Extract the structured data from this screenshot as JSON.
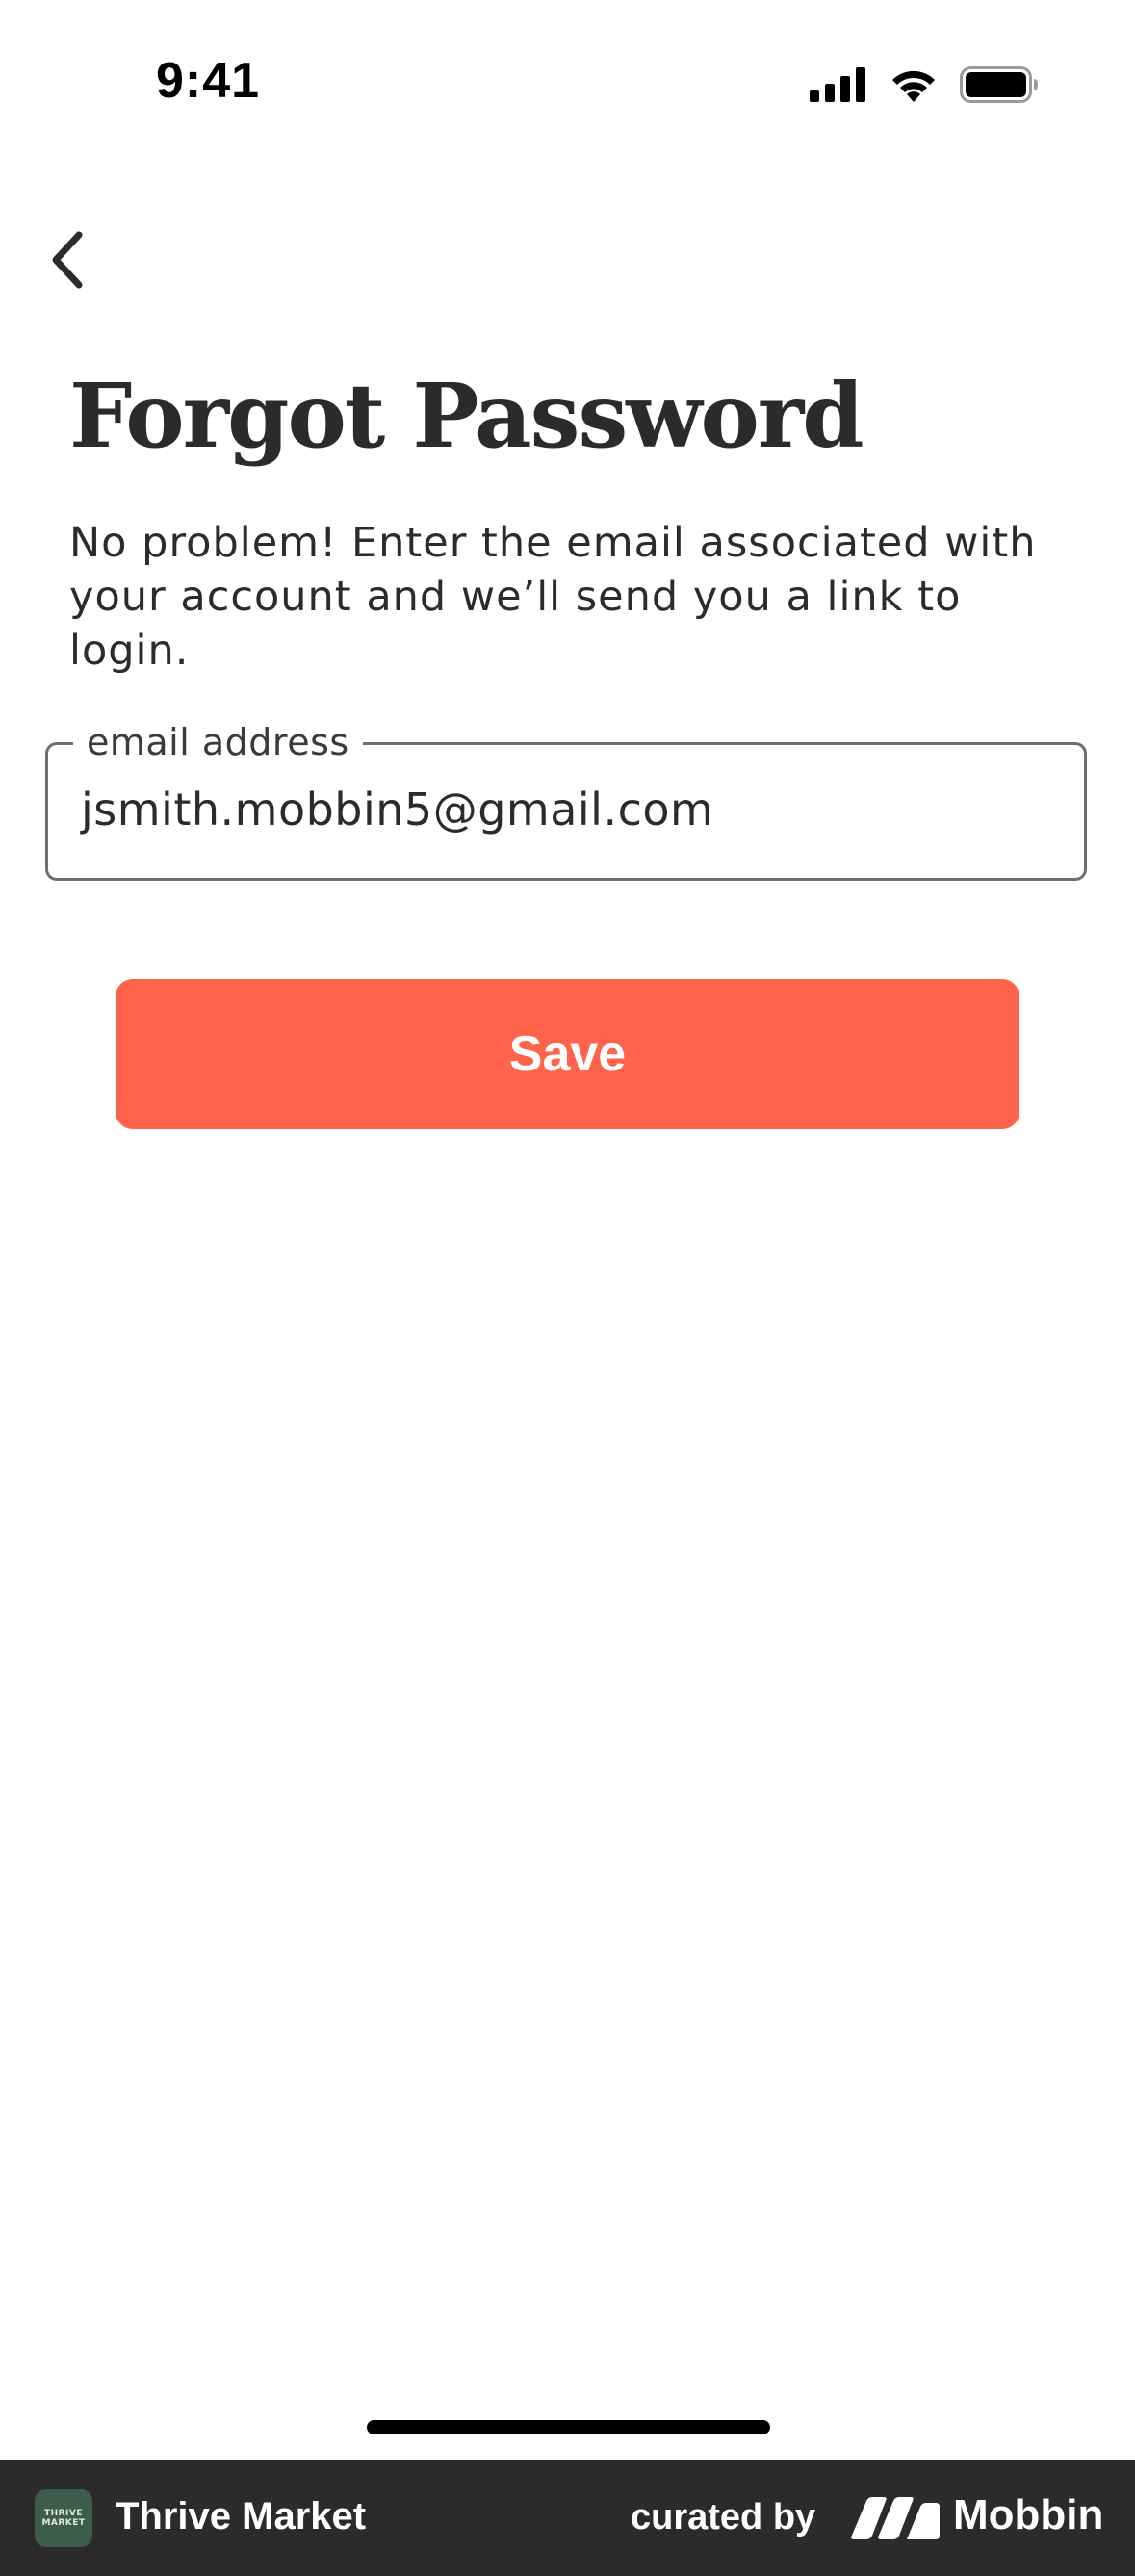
{
  "status_bar": {
    "time": "9:41",
    "icons": [
      "cellular-signal-icon",
      "wifi-icon",
      "battery-icon"
    ]
  },
  "nav": {
    "back_icon": "chevron-left-icon"
  },
  "page": {
    "title": "Forgot Password",
    "description": "No problem! Enter the email associated with your account and we’ll send you a link to login."
  },
  "form": {
    "email_label": "email address",
    "email_value": "jsmith.mobbin5@gmail.com",
    "save_label": "Save"
  },
  "footer": {
    "app_name": "Thrive Market",
    "app_logo_text": "THRIVE MARKET",
    "curated_by": "curated by",
    "brand": "Mobbin"
  },
  "colors": {
    "accent": "#fe634c",
    "text": "#2b2b2b",
    "footer_bg": "#2b2b2b",
    "app_logo_bg": "#3c5c4e"
  }
}
